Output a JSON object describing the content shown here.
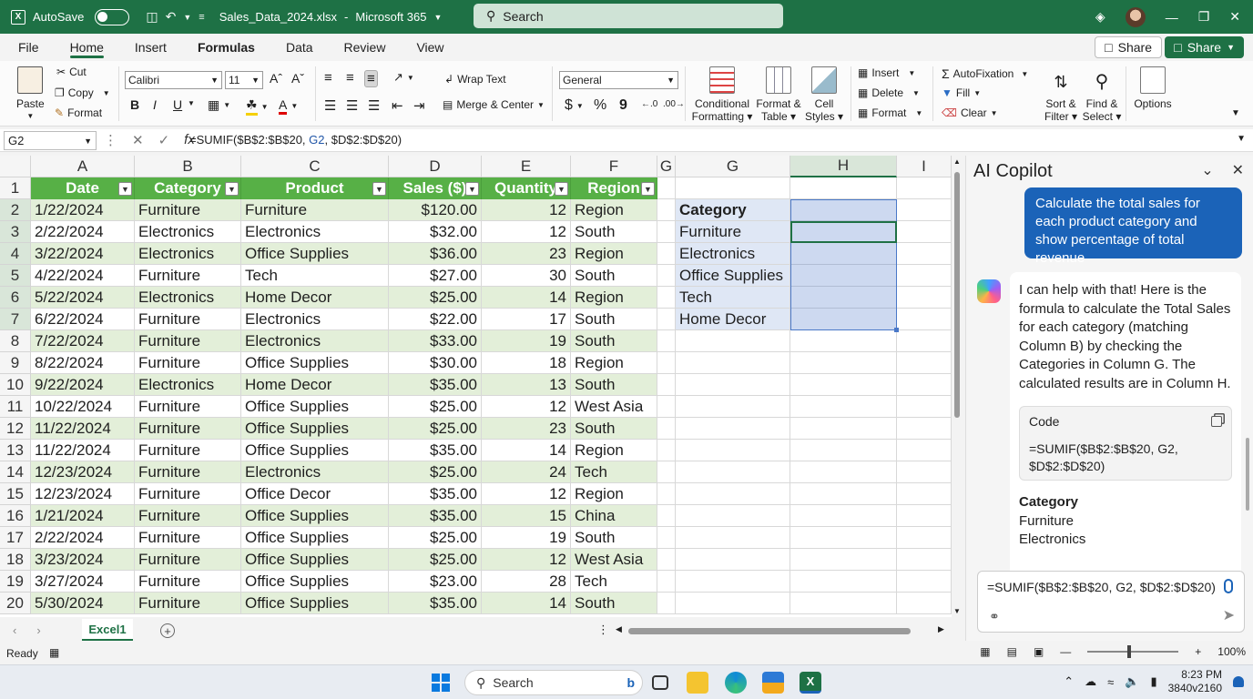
{
  "titlebar": {
    "autosave_label": "AutoSave",
    "filename": "Sales_Data_2024.xlsx",
    "app_label": "Microsoft 365",
    "search_placeholder": "Search"
  },
  "menu": {
    "tabs": [
      "File",
      "Home",
      "Insert",
      "Formulas",
      "Data",
      "Review",
      "View"
    ],
    "active_tab": "Home",
    "share_label": "Share",
    "share_primary_label": "Share"
  },
  "ribbon": {
    "paste": "Paste",
    "cut": "Cut",
    "copy": "Copy",
    "format_painter": "Format",
    "font_name": "Calibri",
    "font_size": "11",
    "bold": "B",
    "italic": "I",
    "underline": "U",
    "wrap_text": "Wrap Text",
    "merge_center": "Merge & Center",
    "number_format": "General",
    "currency": "$",
    "percent": "%",
    "comma": "9",
    "conditional_formatting": [
      "Conditional",
      "Formatting"
    ],
    "format_as_table": [
      "Format &",
      "Table"
    ],
    "cell_styles": [
      "Cell",
      "Styles"
    ],
    "insert": "Insert",
    "delete": "Delete",
    "format": "Format",
    "autosum": "AutoFixation",
    "fill": "Fill",
    "clear": "Clear",
    "sort_filter": [
      "Sort &",
      "Filter"
    ],
    "find_select": [
      "Find &",
      "Select"
    ],
    "options": "Options"
  },
  "formula_bar": {
    "name_box": "G2",
    "formula_prefix": "=SUMIF($B$2:$B$20, ",
    "formula_ref": "G2",
    "formula_suffix": ", $D$2:$D$20)"
  },
  "grid": {
    "columns": [
      "A",
      "B",
      "C",
      "D",
      "E",
      "F",
      "G",
      "G",
      "H",
      "I"
    ],
    "headers": [
      "Date",
      "Category",
      "Product",
      "Sales ($)",
      "Quantity",
      "Region"
    ],
    "rows": [
      [
        "1/22/2024",
        "Furniture",
        "Furniture",
        "$120.00",
        "12",
        "Region"
      ],
      [
        "2/22/2024",
        "Electronics",
        "Electronics",
        "$32.00",
        "12",
        "South"
      ],
      [
        "3/22/2024",
        "Electronics",
        "Office Supplies",
        "$36.00",
        "23",
        "Region"
      ],
      [
        "4/22/2024",
        "Furniture",
        "Tech",
        "$27.00",
        "30",
        "South"
      ],
      [
        "5/22/2024",
        "Electronics",
        "Home Decor",
        "$25.00",
        "14",
        "Region"
      ],
      [
        "6/22/2024",
        "Furniture",
        "Electronics",
        "$22.00",
        "17",
        "South"
      ],
      [
        "7/22/2024",
        "Furniture",
        "Electronics",
        "$33.00",
        "19",
        "South"
      ],
      [
        "8/22/2024",
        "Furniture",
        "Office Supplies",
        "$30.00",
        "18",
        "Region"
      ],
      [
        "9/22/2024",
        "Electronics",
        "Home Decor",
        "$35.00",
        "13",
        "South"
      ],
      [
        "10/22/2024",
        "Furniture",
        "Office Supplies",
        "$25.00",
        "12",
        "West Asia"
      ],
      [
        "11/22/2024",
        "Furniture",
        "Office Supplies",
        "$25.00",
        "23",
        "South"
      ],
      [
        "11/22/2024",
        "Furniture",
        "Office Supplies",
        "$35.00",
        "14",
        "Region"
      ],
      [
        "12/23/2024",
        "Furniture",
        "Electronics",
        "$25.00",
        "24",
        "Tech"
      ],
      [
        "12/23/2024",
        "Furniture",
        "Office Decor",
        "$35.00",
        "12",
        "Region"
      ],
      [
        "1/21/2024",
        "Furniture",
        "Office Supplies",
        "$35.00",
        "15",
        "China"
      ],
      [
        "2/22/2024",
        "Furniture",
        "Office Supplies",
        "$25.00",
        "19",
        "South"
      ],
      [
        "3/23/2024",
        "Furniture",
        "Office Supplies",
        "$25.00",
        "12",
        "West Asia"
      ],
      [
        "3/27/2024",
        "Furniture",
        "Office Supplies",
        "$23.00",
        "28",
        "Tech"
      ],
      [
        "5/30/2024",
        "Furniture",
        "Office Supplies",
        "$35.00",
        "14",
        "South"
      ]
    ],
    "side_table": [
      "Category",
      "Furniture",
      "Electronics",
      "Office Supplies",
      "Tech",
      "Home Decor"
    ]
  },
  "copilot": {
    "title": "AI Copilot",
    "user_message": "Calculate the total sales for each product category and show percentage of total revenue",
    "ai_message": "I can help with that! Here is the formula to calculate the Total Sales for each category (matching Column B) by checking the Categories in Column G. The calculated results are in Column H.",
    "code_label": "Code",
    "code_text": "=SUMIF($B$2:$B$20, G2, $D$2:$D$20)",
    "list_title": "Category",
    "list_items": [
      "Furniture",
      "Electronics"
    ],
    "input_value": "=SUMIF($B$2:$B$20, G2, $D$2:$D$20)"
  },
  "sheets": {
    "active": "Excel1"
  },
  "status": {
    "ready": "Ready",
    "zoom": "100%"
  },
  "taskbar": {
    "search_placeholder": "Search",
    "time": "8:23 PM",
    "resolution": "3840v2160"
  },
  "colors": {
    "excel_green": "#1e7145",
    "header_green": "#57b046",
    "band_green": "#e3efd9",
    "copilot_blue": "#1b63b8"
  }
}
